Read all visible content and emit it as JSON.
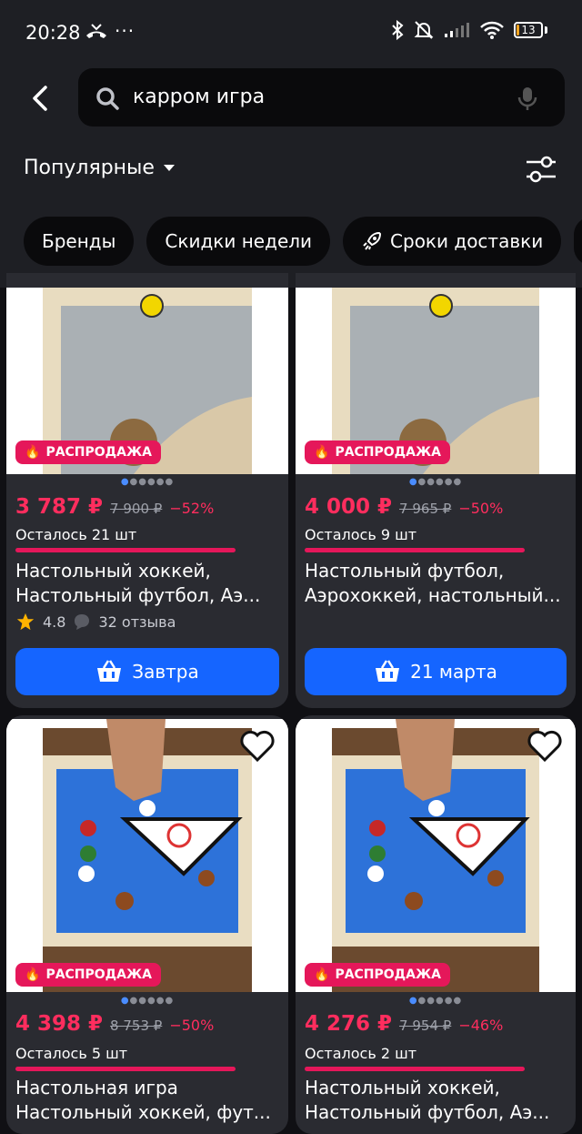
{
  "status_bar": {
    "time": "20:28",
    "dots": "···",
    "battery": "13"
  },
  "search": {
    "query": "карром игра"
  },
  "sort": {
    "label": "Популярные"
  },
  "chips": [
    "Бренды",
    "Скидки недели",
    "Сроки доставки"
  ],
  "badge_label": "РАСПРОДАЖА",
  "products": [
    {
      "price": "3 787 ₽",
      "old_price": "7 900 ₽",
      "discount": "−52%",
      "stock": "Осталось 21 шт",
      "title_line1": "Настольный хоккей,",
      "title_line2": "Настольный футбол, Аэ...",
      "rating": "4.8",
      "reviews": "32 отзыва",
      "delivery": "Завтра"
    },
    {
      "price": "4 000 ₽",
      "old_price": "7 965 ₽",
      "discount": "−50%",
      "stock": "Осталось 9 шт",
      "title_line1": "Настольный футбол,",
      "title_line2": "Аэрохоккей, настольный...",
      "delivery": "21 марта"
    },
    {
      "price": "4 398 ₽",
      "old_price": "8 753 ₽",
      "discount": "−50%",
      "stock": "Осталось 5 шт",
      "title_line1": "Настольная игра",
      "title_line2": "Настольный хоккей, фут..."
    },
    {
      "price": "4 276 ₽",
      "old_price": "7 954 ₽",
      "discount": "−46%",
      "stock": "Осталось 2 шт",
      "title_line1": "Настольный хоккей,",
      "title_line2": "Настольный футбол, Аэ..."
    }
  ],
  "colors": {
    "accent_pink": "#ff2d5e",
    "buy_blue": "#1565ff",
    "header_bg": "#1e1f24"
  }
}
